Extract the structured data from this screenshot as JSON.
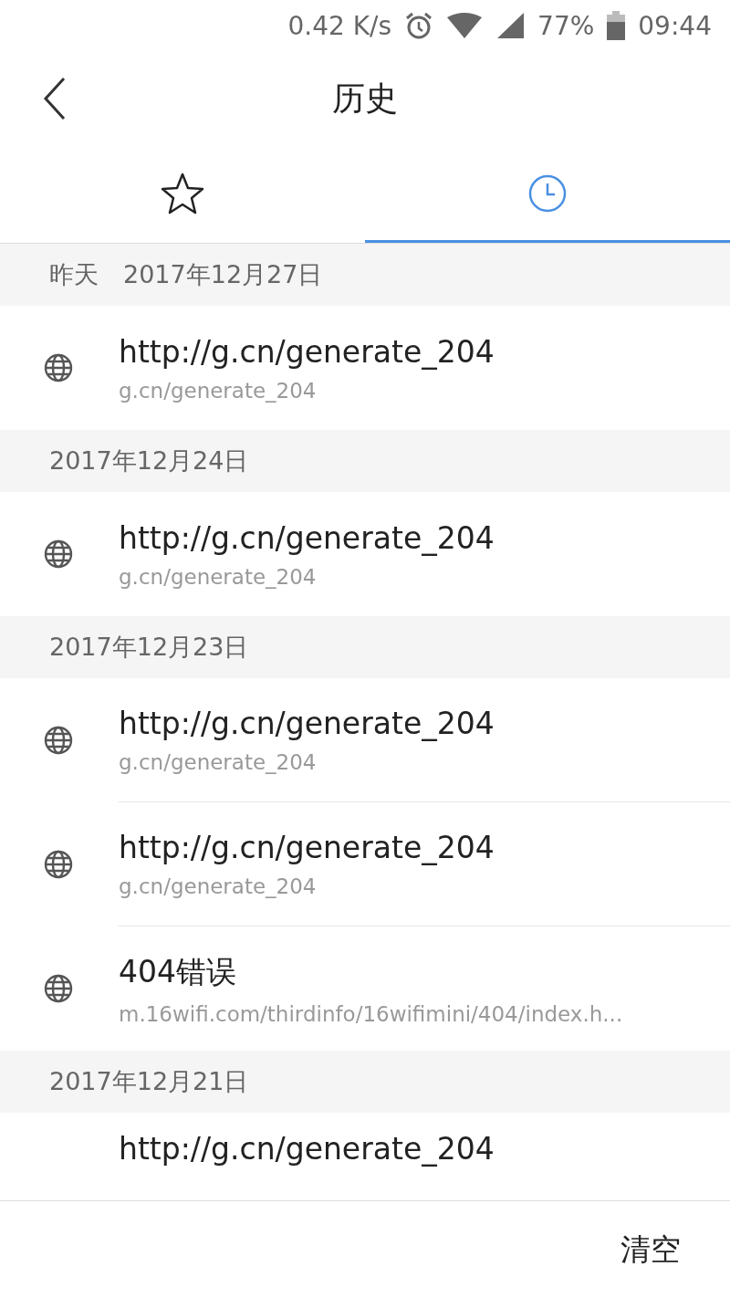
{
  "status_bar": {
    "speed": "0.42 K/s",
    "battery": "77%",
    "time": "09:44"
  },
  "header": {
    "title": "历史"
  },
  "tabs": [
    {
      "kind": "bookmarks",
      "selected": false
    },
    {
      "kind": "history",
      "selected": true
    }
  ],
  "sections": [
    {
      "date": "昨天　2017年12月27日",
      "items": [
        {
          "title": "http://g.cn/generate_204",
          "url": "g.cn/generate_204"
        }
      ]
    },
    {
      "date": "2017年12月24日",
      "items": [
        {
          "title": "http://g.cn/generate_204",
          "url": "g.cn/generate_204"
        }
      ]
    },
    {
      "date": "2017年12月23日",
      "items": [
        {
          "title": "http://g.cn/generate_204",
          "url": "g.cn/generate_204"
        },
        {
          "title": "http://g.cn/generate_204",
          "url": "g.cn/generate_204"
        },
        {
          "title": "404错误",
          "url": "m.16wifi.com/thirdinfo/16wifimini/404/index.h..."
        }
      ]
    },
    {
      "date": "2017年12月21日",
      "items": [
        {
          "title": "http://g.cn/generate_204"
        }
      ]
    }
  ],
  "bottom_bar": {
    "clear_button": "清空"
  }
}
